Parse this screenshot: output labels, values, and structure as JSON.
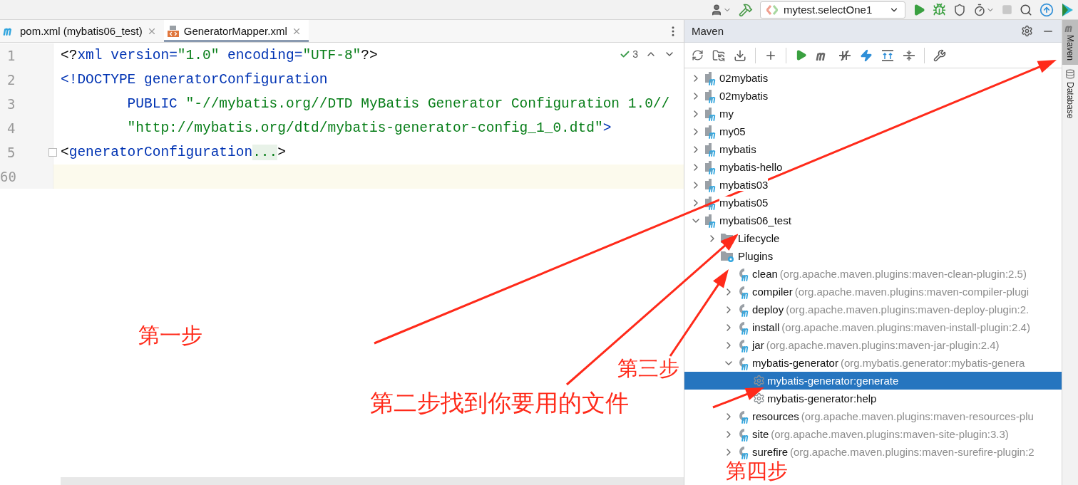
{
  "toolbar": {
    "run_config": "mytest.selectOne1"
  },
  "editor": {
    "tabs": [
      {
        "label": "pom.xml (mybatis06_test)",
        "kind": "maven",
        "selected": false
      },
      {
        "label": "GeneratorMapper.xml",
        "kind": "xml",
        "selected": true
      }
    ],
    "inspection_count": "3",
    "lines": [
      {
        "number": "1",
        "current": false,
        "folded": false,
        "tokens": [
          {
            "text": "<?",
            "kind": "punct"
          },
          {
            "text": "xml version=",
            "kind": "keyword"
          },
          {
            "text": "\"1.0\"",
            "kind": "string"
          },
          {
            "text": " encoding=",
            "kind": "keyword"
          },
          {
            "text": "\"UTF-8\"",
            "kind": "string"
          },
          {
            "text": "?>",
            "kind": "punct"
          }
        ]
      },
      {
        "number": "2",
        "current": false,
        "folded": false,
        "tokens": [
          {
            "text": "<!DOCTYPE generatorConfiguration",
            "kind": "keyword"
          }
        ]
      },
      {
        "number": "3",
        "current": false,
        "folded": false,
        "tokens": [
          {
            "text": "        PUBLIC ",
            "kind": "keyword"
          },
          {
            "text": "\"-//mybatis.org//DTD MyBatis Generator Configuration 1.0//",
            "kind": "string"
          }
        ]
      },
      {
        "number": "4",
        "current": false,
        "folded": false,
        "tokens": [
          {
            "text": "        \"http://mybatis.org/dtd/mybatis-generator-config_1_0.dtd\"",
            "kind": "string"
          },
          {
            "text": ">",
            "kind": "keyword"
          }
        ]
      },
      {
        "number": "5",
        "current": false,
        "folded": true,
        "tokens": [
          {
            "text": "<",
            "kind": "punct"
          },
          {
            "text": "generatorConfiguration",
            "kind": "keyword"
          },
          {
            "text": "...",
            "kind": "fold"
          },
          {
            "text": ">",
            "kind": "punct"
          }
        ]
      },
      {
        "number": "60",
        "current": true,
        "folded": false
      }
    ]
  },
  "maven": {
    "title": "Maven",
    "tree": [
      {
        "label": "02mybatis",
        "kind": "project",
        "expanded": false,
        "selected": false
      },
      {
        "label": "02mybatis",
        "kind": "project",
        "expanded": false,
        "selected": false
      },
      {
        "label": "my",
        "kind": "project",
        "expanded": false,
        "selected": false
      },
      {
        "label": "my05",
        "kind": "project",
        "expanded": false,
        "selected": false
      },
      {
        "label": "mybatis",
        "kind": "project",
        "expanded": false,
        "selected": false
      },
      {
        "label": "mybatis-hello",
        "kind": "project",
        "expanded": false,
        "selected": false
      },
      {
        "label": "mybatis03",
        "kind": "project",
        "expanded": false,
        "selected": false
      },
      {
        "label": "mybatis05",
        "kind": "project",
        "expanded": false,
        "selected": false
      },
      {
        "label": "mybatis06_test",
        "kind": "project",
        "expanded": true,
        "selected": false,
        "children": [
          {
            "label": "Lifecycle",
            "kind": "folder",
            "expanded": false,
            "selected": false
          },
          {
            "label": "Plugins",
            "kind": "folder",
            "selected": false,
            "children": [
              {
                "label": "clean",
                "detail": "(org.apache.maven.plugins:maven-clean-plugin:2.5)",
                "kind": "plugin",
                "selected": false
              },
              {
                "label": "compiler",
                "detail": "(org.apache.maven.plugins:maven-compiler-plugi",
                "kind": "plugin",
                "expanded": false,
                "selected": false
              },
              {
                "label": "deploy",
                "detail": "(org.apache.maven.plugins:maven-deploy-plugin:2.",
                "kind": "plugin",
                "expanded": false,
                "selected": false
              },
              {
                "label": "install",
                "detail": "(org.apache.maven.plugins:maven-install-plugin:2.4)",
                "kind": "plugin",
                "expanded": false,
                "selected": false
              },
              {
                "label": "jar",
                "detail": "(org.apache.maven.plugins:maven-jar-plugin:2.4)",
                "kind": "plugin",
                "expanded": false,
                "selected": false
              },
              {
                "label": "mybatis-generator",
                "detail": "(org.mybatis.generator:mybatis-genera",
                "kind": "plugin",
                "expanded": true,
                "selected": false,
                "children": [
                  {
                    "label": "mybatis-generator:generate",
                    "kind": "goal",
                    "selected": true
                  },
                  {
                    "label": "mybatis-generator:help",
                    "kind": "goal",
                    "selected": false
                  }
                ]
              },
              {
                "label": "resources",
                "detail": "(org.apache.maven.plugins:maven-resources-plu",
                "kind": "plugin",
                "expanded": false,
                "selected": false
              },
              {
                "label": "site",
                "detail": "(org.apache.maven.plugins:maven-site-plugin:3.3)",
                "kind": "plugin",
                "expanded": false,
                "selected": false
              },
              {
                "label": "surefire",
                "detail": "(org.apache.maven.plugins:maven-surefire-plugin:2",
                "kind": "plugin",
                "expanded": false,
                "selected": false
              }
            ]
          }
        ]
      }
    ]
  },
  "side_tabs": [
    {
      "label": "Maven",
      "selected": true
    },
    {
      "label": "Database",
      "selected": false
    }
  ],
  "annotations": [
    {
      "text": "第一步"
    },
    {
      "text": "第二步找到你要用的文件"
    },
    {
      "text": "第三步"
    },
    {
      "text": "第四步"
    }
  ]
}
